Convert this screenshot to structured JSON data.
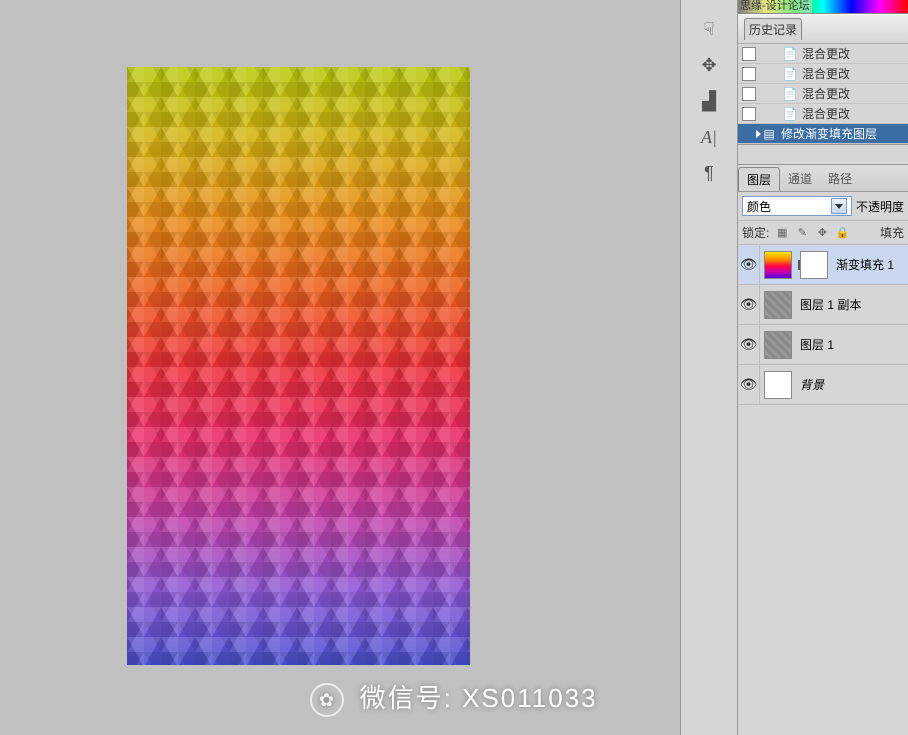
{
  "watermark_top": "思缘-设计论坛",
  "history": {
    "title": "历史记录",
    "items": [
      {
        "label": "混合更改",
        "selected": false
      },
      {
        "label": "混合更改",
        "selected": false
      },
      {
        "label": "混合更改",
        "selected": false
      },
      {
        "label": "混合更改",
        "selected": false
      },
      {
        "label": "修改渐变填充图层",
        "selected": true
      }
    ]
  },
  "layers_panel": {
    "tabs": [
      "图层",
      "通道",
      "路径"
    ],
    "active_tab": 0,
    "blend_mode": "颜色",
    "opacity_label": "不透明度",
    "lock_label": "锁定:",
    "fill_label": "填充",
    "layers": [
      {
        "name": "渐变填充 1",
        "thumb": "gradient",
        "has_mask": true,
        "selected": true,
        "visible": true,
        "italic": false
      },
      {
        "name": "图层 1 副本",
        "thumb": "gray",
        "has_mask": false,
        "selected": false,
        "visible": true,
        "italic": false
      },
      {
        "name": "图层 1",
        "thumb": "gray",
        "has_mask": false,
        "selected": false,
        "visible": true,
        "italic": false
      },
      {
        "name": "背景",
        "thumb": "white",
        "has_mask": false,
        "selected": false,
        "visible": true,
        "italic": true
      }
    ]
  },
  "tools": {
    "icons": [
      "hand-pointing-icon",
      "adjust-icon",
      "stamp-icon",
      "text-a-icon",
      "pilcrow-icon"
    ]
  },
  "caption": {
    "label_prefix": "微信号: ",
    "number": "XS011033"
  },
  "chart_data": {
    "type": "table",
    "note": "no quantitative chart present; canvas is a decorative triangle mosaic with vertical rainbow gradient"
  }
}
